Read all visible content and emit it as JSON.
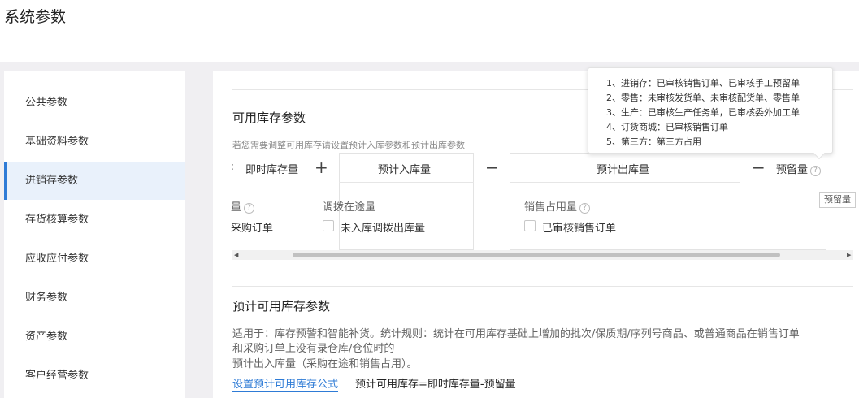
{
  "header": {
    "title": "系统参数"
  },
  "sidebar": {
    "items": [
      {
        "label": "公共参数"
      },
      {
        "label": "基础资料参数"
      },
      {
        "label": "进销存参数",
        "active": true
      },
      {
        "label": "存货核算参数"
      },
      {
        "label": "应收应付参数"
      },
      {
        "label": "财务参数"
      },
      {
        "label": "资产参数"
      },
      {
        "label": "客户经营参数"
      }
    ]
  },
  "available": {
    "title": "可用库存参数",
    "hint": "若您需要调整可用库存请设置预计入库参数和预计出库参数",
    "col_current": "即时库存量",
    "op_plus": "+",
    "col_in": "预计入库量",
    "op_minus": "−",
    "col_out": "预计出库量",
    "op_minus2": "−",
    "col_reserved": "预留量",
    "partial_left_label": "量",
    "transfer_label": "调拨在途量",
    "purchase_order": "采购订单",
    "transfer_unshipped": "未入库调拨出库量",
    "sales_occupied": "销售占用量",
    "sales_order_audited": "已审核销售订单",
    "qmark": "?"
  },
  "tooltip": {
    "lines": [
      "1、进销存：已审核销售订单、已审核手工预留单",
      "2、零售：未审核发货单、未审核配货单、零售单",
      "3、生产：已审核生产任务单，已审核委外加工单",
      "4、订货商城：已审核销售订单",
      "5、第三方：第三方占用"
    ],
    "mini": "预留量"
  },
  "forecast": {
    "title": "预计可用库存参数",
    "desc_line1": "适用于：库存预警和智能补货。统计规则：统计在可用库存基础上增加的批次/保质期/序列号商品、或普通商品在销售订单",
    "desc_line2": "和采购订单上没有录仓库/仓位时的",
    "desc_line3": "预计出入库量（采购在途和销售占用）。",
    "link": "设置预计可用库存公式",
    "formula": "预计可用库存=即时库存量-预留量"
  },
  "scroll": {
    "left_arrow": "◀",
    "right_arrow": "▶"
  }
}
